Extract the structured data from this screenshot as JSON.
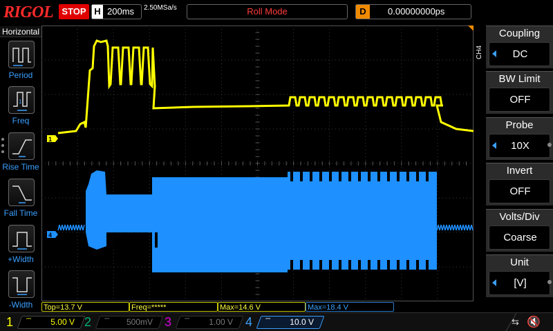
{
  "header": {
    "brand": "RIGOL",
    "run_state": "STOP",
    "horizontal_key": "H",
    "timebase": "200ms",
    "sample_rate": "2.50MSa/s",
    "mode": "Roll Mode",
    "delay_key": "D",
    "delay_value": "0.00000000ps"
  },
  "left_menu": {
    "title": "Horizontal",
    "items": [
      {
        "label": "Period",
        "icon": "period-icon"
      },
      {
        "label": "Freq",
        "icon": "frequency-icon"
      },
      {
        "label": "Rise Time",
        "icon": "rise-time-icon"
      },
      {
        "label": "Fall Time",
        "icon": "fall-time-icon"
      },
      {
        "label": "+Width",
        "icon": "positive-width-icon"
      },
      {
        "label": "-Width",
        "icon": "negative-width-icon"
      }
    ]
  },
  "right_menu": {
    "channel_tab": "CH4",
    "items": [
      {
        "title": "Coupling",
        "value": "DC",
        "has_arrow": true
      },
      {
        "title": "BW Limit",
        "value": "OFF",
        "has_arrow": false
      },
      {
        "title": "Probe",
        "value": "10X",
        "has_arrow": true
      },
      {
        "title": "Invert",
        "value": "OFF",
        "has_arrow": false
      },
      {
        "title": "Volts/Div",
        "value": "Coarse",
        "has_arrow": false
      },
      {
        "title": "Unit",
        "value": "[V]",
        "has_arrow": true
      }
    ]
  },
  "markers": {
    "ch1": "1",
    "ch4": "4"
  },
  "measurements": [
    {
      "text": "Top=13.7 V",
      "color": "yellow"
    },
    {
      "text": "Freq=*****",
      "color": "yellow"
    },
    {
      "text": "Max=14.6 V",
      "color": "yellow"
    },
    {
      "text": "Max=18.4 V",
      "color": "blue"
    }
  ],
  "channels": [
    {
      "number": "1",
      "scale": "5.00 V",
      "active": true
    },
    {
      "number": "2",
      "scale": "500mV",
      "active": false
    },
    {
      "number": "3",
      "scale": "1.00 V",
      "active": false
    },
    {
      "number": "4",
      "scale": "10.0 V",
      "active": true
    }
  ],
  "colors": {
    "ch1": "#ffff00",
    "ch2": "#00b070",
    "ch3": "#d000d0",
    "ch4": "#1e90ff",
    "stop": "#e00000",
    "brand": "#ff2a2a"
  }
}
